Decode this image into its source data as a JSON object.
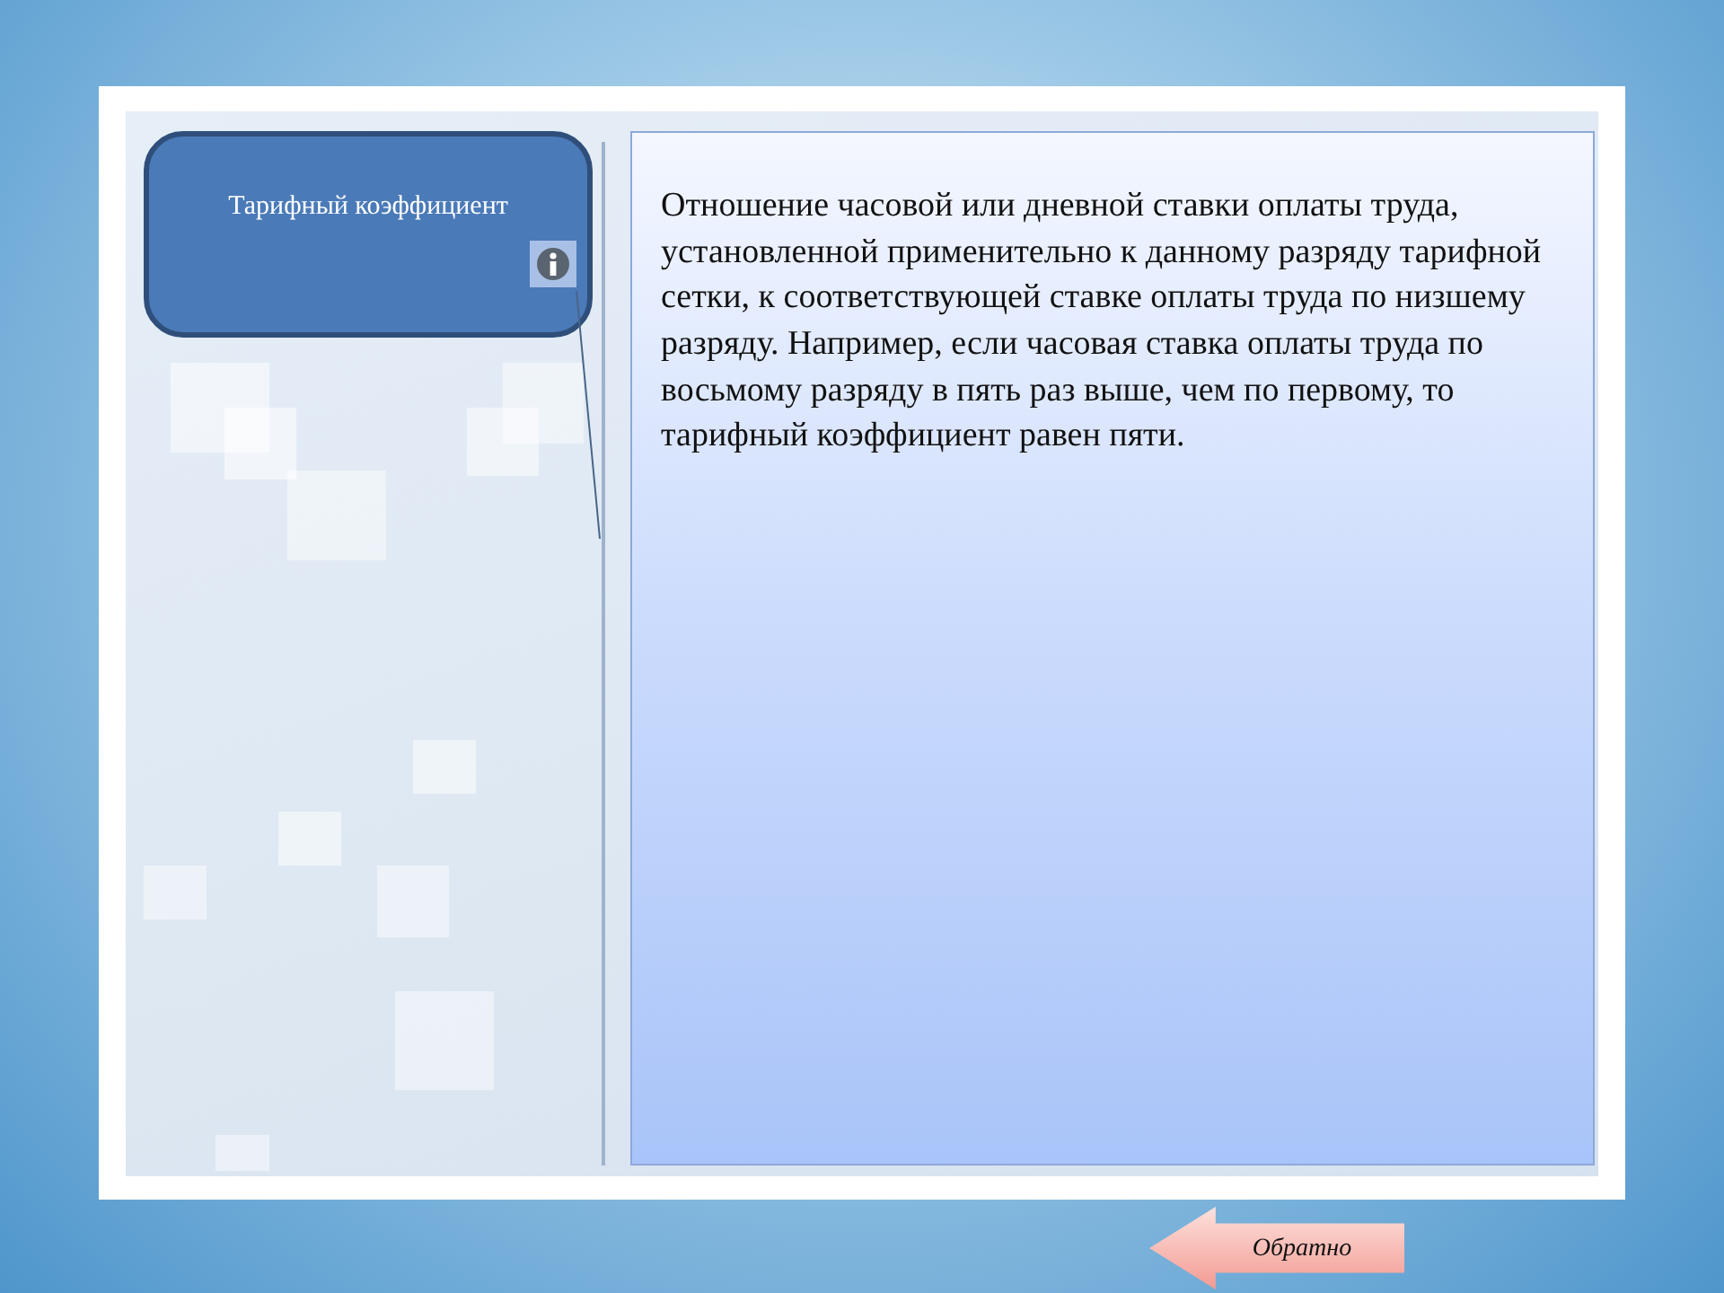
{
  "term_box": {
    "title": "Тарифный коэффициент"
  },
  "definition": {
    "text": "Отношение часовой или дневной ставки оплаты труда, установленной применительно к данному разряду тарифной сетки, к соответствующей ставке оплаты труда по низшему разряду. Например, если часовая ставка оплаты труда по восьмому разряду в пять раз выше, чем по первому, то тарифный коэффициент равен пяти."
  },
  "back_button": {
    "label": "Обратно"
  }
}
